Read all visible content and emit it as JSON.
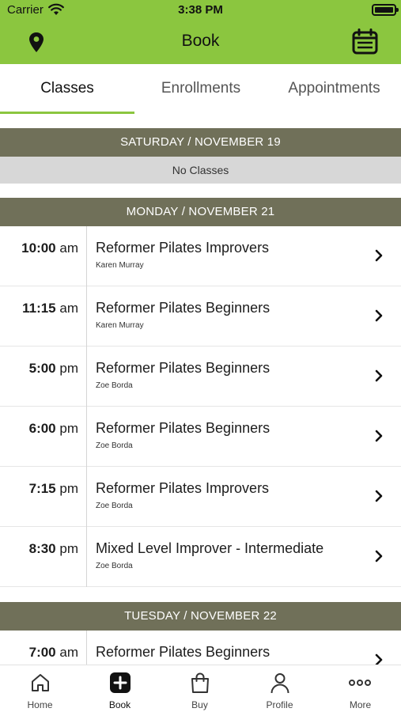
{
  "status_bar": {
    "carrier": "Carrier",
    "time": "3:38 PM"
  },
  "nav": {
    "title": "Book",
    "left_icon": "location-pin-icon",
    "right_icon": "calendar-icon"
  },
  "tabs": [
    {
      "label": "Classes",
      "active": true
    },
    {
      "label": "Enrollments",
      "active": false
    },
    {
      "label": "Appointments",
      "active": false
    }
  ],
  "days": [
    {
      "header": "SATURDAY / NOVEMBER 19",
      "empty_text": "No Classes",
      "classes": []
    },
    {
      "header": "MONDAY / NOVEMBER 21",
      "classes": [
        {
          "time": "10:00",
          "ampm": "am",
          "name": "Reformer Pilates Improvers",
          "instructor": "Karen Murray"
        },
        {
          "time": "11:15",
          "ampm": "am",
          "name": "Reformer Pilates Beginners",
          "instructor": "Karen Murray"
        },
        {
          "time": "5:00",
          "ampm": "pm",
          "name": "Reformer Pilates Beginners",
          "instructor": "Zoe Borda"
        },
        {
          "time": "6:00",
          "ampm": "pm",
          "name": "Reformer Pilates Beginners",
          "instructor": "Zoe Borda"
        },
        {
          "time": "7:15",
          "ampm": "pm",
          "name": "Reformer Pilates Improvers",
          "instructor": "Zoe Borda"
        },
        {
          "time": "8:30",
          "ampm": "pm",
          "name": "Mixed Level Improver - Intermediate",
          "instructor": "Zoe Borda"
        }
      ]
    },
    {
      "header": "TUESDAY / NOVEMBER 22",
      "classes": [
        {
          "time": "7:00",
          "ampm": "am",
          "name": "Reformer Pilates Beginners",
          "instructor": ""
        }
      ]
    }
  ],
  "tab_bar": [
    {
      "label": "Home",
      "icon": "home-icon",
      "active": false
    },
    {
      "label": "Book",
      "icon": "plus-square-icon",
      "active": true
    },
    {
      "label": "Buy",
      "icon": "shopping-bag-icon",
      "active": false
    },
    {
      "label": "Profile",
      "icon": "person-icon",
      "active": false
    },
    {
      "label": "More",
      "icon": "more-dots-icon",
      "active": false
    }
  ],
  "colors": {
    "accent": "#8bc63f",
    "day_header": "#707059",
    "no_classes_bg": "#d7d7d7"
  }
}
